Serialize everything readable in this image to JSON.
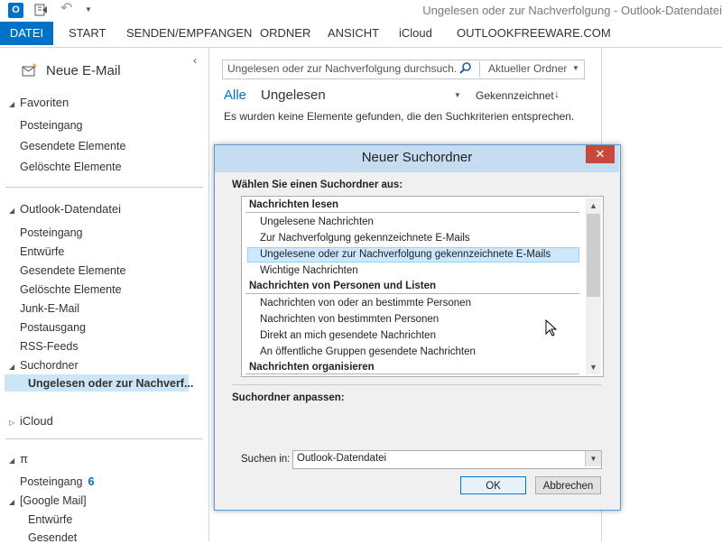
{
  "window": {
    "title": "Ungelesen oder zur Nachverfolgung - Outlook-Datendatei"
  },
  "quick_access": {
    "app_icon": "O",
    "icons": [
      "outlook-icon",
      "send-receive-icon",
      "undo-icon",
      "customize-icon"
    ]
  },
  "ribbon": {
    "tabs": [
      "DATEI",
      "START",
      "SENDEN/EMPFANGEN",
      "ORDNER",
      "ANSICHT",
      "iCloud",
      "OUTLOOKFREEWARE.COM"
    ],
    "active_tab": "DATEI",
    "accent": "#0072c6"
  },
  "folder_pane": {
    "new_mail": "Neue E-Mail",
    "favorites": {
      "title": "Favoriten",
      "items": [
        "Posteingang",
        "Gesendete Elemente",
        "Gelöschte Elemente"
      ]
    },
    "datafile": {
      "title": "Outlook-Datendatei",
      "items": [
        "Posteingang",
        "Entwürfe",
        "Gesendete Elemente",
        "Gelöschte Elemente",
        "Junk-E-Mail",
        "Postausgang",
        "RSS-Feeds",
        "Suchordner"
      ],
      "selected": "Ungelesen oder zur Nachverf..."
    },
    "icloud": {
      "title": "iCloud"
    },
    "account": {
      "title": "π",
      "inbox": "Posteingang",
      "inbox_count": "6",
      "google": "[Google Mail]",
      "sub_items": [
        "Entwürfe",
        "Gesendet"
      ]
    }
  },
  "main": {
    "search_placeholder": "Ungelesen oder zur Nachverfolgung durchsuch...",
    "scope": "Aktueller Ordner",
    "filter_all": "Alle",
    "filter_unread": "Ungelesen",
    "sort": "Gekennzeichnet",
    "empty_message": "Es wurden keine Elemente gefunden, die den Suchkriterien entsprechen."
  },
  "dialog": {
    "title": "Neuer Suchordner",
    "close": "✕",
    "prompt": "Wählen Sie einen Suchordner aus:",
    "groups": [
      {
        "header": "Nachrichten lesen",
        "items": [
          "Ungelesene Nachrichten",
          "Zur Nachverfolgung gekennzeichnete E-Mails",
          "Ungelesene oder zur Nachverfolgung gekennzeichnete E-Mails",
          "Wichtige Nachrichten"
        ]
      },
      {
        "header": "Nachrichten von Personen und Listen",
        "items": [
          "Nachrichten von oder an bestimmte Personen",
          "Nachrichten von bestimmten Personen",
          "Direkt an mich gesendete Nachrichten",
          "An öffentliche Gruppen gesendete Nachrichten"
        ]
      },
      {
        "header": "Nachrichten organisieren",
        "items": []
      }
    ],
    "selected_item": "Ungelesene oder zur Nachverfolgung gekennzeichnete E-Mails",
    "customize_label": "Suchordner anpassen:",
    "search_in_label": "Suchen in:",
    "search_in_value": "Outlook-Datendatei",
    "ok": "OK",
    "cancel": "Abbrechen"
  }
}
